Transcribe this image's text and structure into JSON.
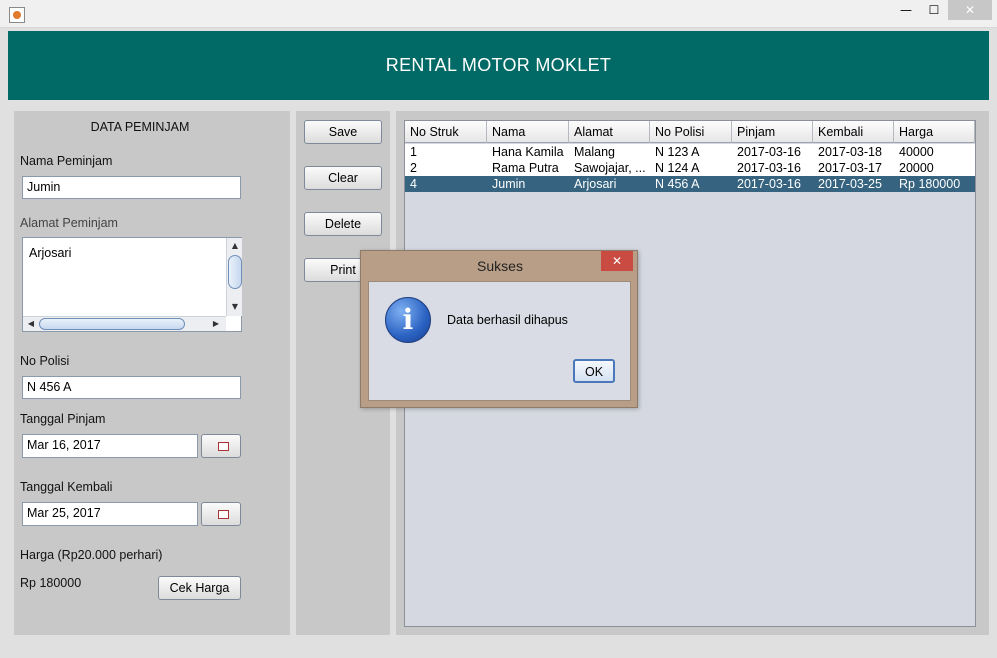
{
  "window": {
    "minimize_glyph": "—",
    "maximize_glyph": "☐",
    "close_glyph": "✕"
  },
  "header": {
    "title": "RENTAL MOTOR MOKLET"
  },
  "form": {
    "section_title": "DATA PEMINJAM",
    "nama_label": "Nama Peminjam",
    "nama_value": "Jumin",
    "alamat_label": "Alamat Peminjam",
    "alamat_value": "Arjosari",
    "polisi_label": "No Polisi",
    "polisi_value": "N 456 A",
    "pinjam_label": "Tanggal Pinjam",
    "pinjam_value": "Mar 16, 2017",
    "kembali_label": "Tanggal Kembali",
    "kembali_value": "Mar 25, 2017",
    "harga_label": "Harga (Rp20.000 perhari)",
    "harga_value": "Rp 180000",
    "cek_harga_button": "Cek Harga"
  },
  "actions": {
    "save": "Save",
    "clear": "Clear",
    "delete": "Delete",
    "print": "Print"
  },
  "table": {
    "columns": [
      "No Struk",
      "Nama",
      "Alamat",
      "No Polisi",
      "Pinjam",
      "Kembali",
      "Harga"
    ],
    "rows": [
      [
        "1",
        "Hana Kamila",
        "Malang",
        "N 123 A",
        "2017-03-16",
        "2017-03-18",
        "40000"
      ],
      [
        "2",
        "Rama Putra",
        "Sawojajar, ...",
        "N 124 A",
        "2017-03-16",
        "2017-03-17",
        "20000"
      ],
      [
        "4",
        "Jumin",
        "Arjosari",
        "N 456 A",
        "2017-03-16",
        "2017-03-25",
        "Rp 180000"
      ]
    ],
    "selected_row_index": 2
  },
  "dialog": {
    "title": "Sukses",
    "message": "Data berhasil dihapus",
    "ok_button": "OK",
    "close_glyph": "✕",
    "icon_glyph": "i"
  },
  "colors": {
    "header_bg": "#016a66",
    "selected_row_bg": "#36637f",
    "dialog_close_bg": "#c94b42"
  }
}
